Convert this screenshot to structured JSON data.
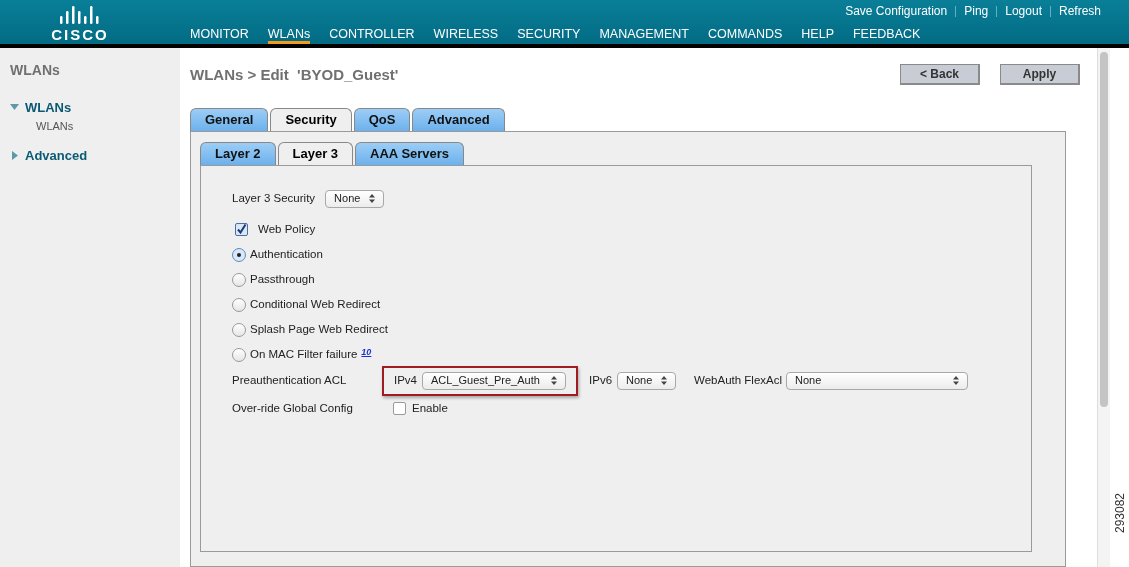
{
  "header": {
    "logo": "CISCO",
    "links": [
      "Save Configuration",
      "Ping",
      "Logout",
      "Refresh"
    ],
    "nav": [
      {
        "label": "MONITOR",
        "selected": false
      },
      {
        "label": "WLANs",
        "selected": true
      },
      {
        "label": "CONTROLLER",
        "selected": false
      },
      {
        "label": "WIRELESS",
        "selected": false
      },
      {
        "label": "SECURITY",
        "selected": false
      },
      {
        "label": "MANAGEMENT",
        "selected": false
      },
      {
        "label": "COMMANDS",
        "selected": false
      },
      {
        "label": "HELP",
        "selected": false
      },
      {
        "label": "FEEDBACK",
        "selected": false
      }
    ]
  },
  "sidebar": {
    "title": "WLANs",
    "items": [
      {
        "label": "WLANs",
        "expanded": true,
        "children": [
          {
            "label": "WLANs"
          }
        ]
      },
      {
        "label": "Advanced",
        "expanded": false
      }
    ]
  },
  "page": {
    "title": "WLANs > Edit  'BYOD_Guest'",
    "buttons": [
      "< Back",
      "Apply"
    ]
  },
  "tabs": [
    {
      "label": "General",
      "selected": false
    },
    {
      "label": "Security",
      "selected": true
    },
    {
      "label": "QoS",
      "selected": false
    },
    {
      "label": "Advanced",
      "selected": false
    }
  ],
  "subtabs": [
    {
      "label": "Layer 2",
      "selected": false
    },
    {
      "label": "Layer 3",
      "selected": true
    },
    {
      "label": "AAA Servers",
      "selected": false
    }
  ],
  "form": {
    "layer3_security": {
      "label": "Layer 3 Security",
      "value": "None"
    },
    "web_policy": {
      "label": "Web Policy",
      "checked": true
    },
    "options": [
      {
        "label": "Authentication",
        "selected": true
      },
      {
        "label": "Passthrough",
        "selected": false
      },
      {
        "label": "Conditional Web Redirect",
        "selected": false
      },
      {
        "label": "Splash Page Web Redirect",
        "selected": false
      },
      {
        "label": "On MAC Filter failure",
        "selected": false,
        "footnote": "10"
      }
    ],
    "preauth_acl": {
      "label": "Preauthentication ACL",
      "ipv4_label": "IPv4",
      "ipv4_value": "ACL_Guest_Pre_Auth",
      "highlighted": true,
      "ipv6_label": "IPv6",
      "ipv6_value": "None",
      "flexacl_label": "WebAuth FlexAcl",
      "flexacl_value": "None"
    },
    "override": {
      "label": "Over-ride Global Config",
      "checkbox_label": "Enable",
      "checked": false
    }
  },
  "figure_number": "293082"
}
